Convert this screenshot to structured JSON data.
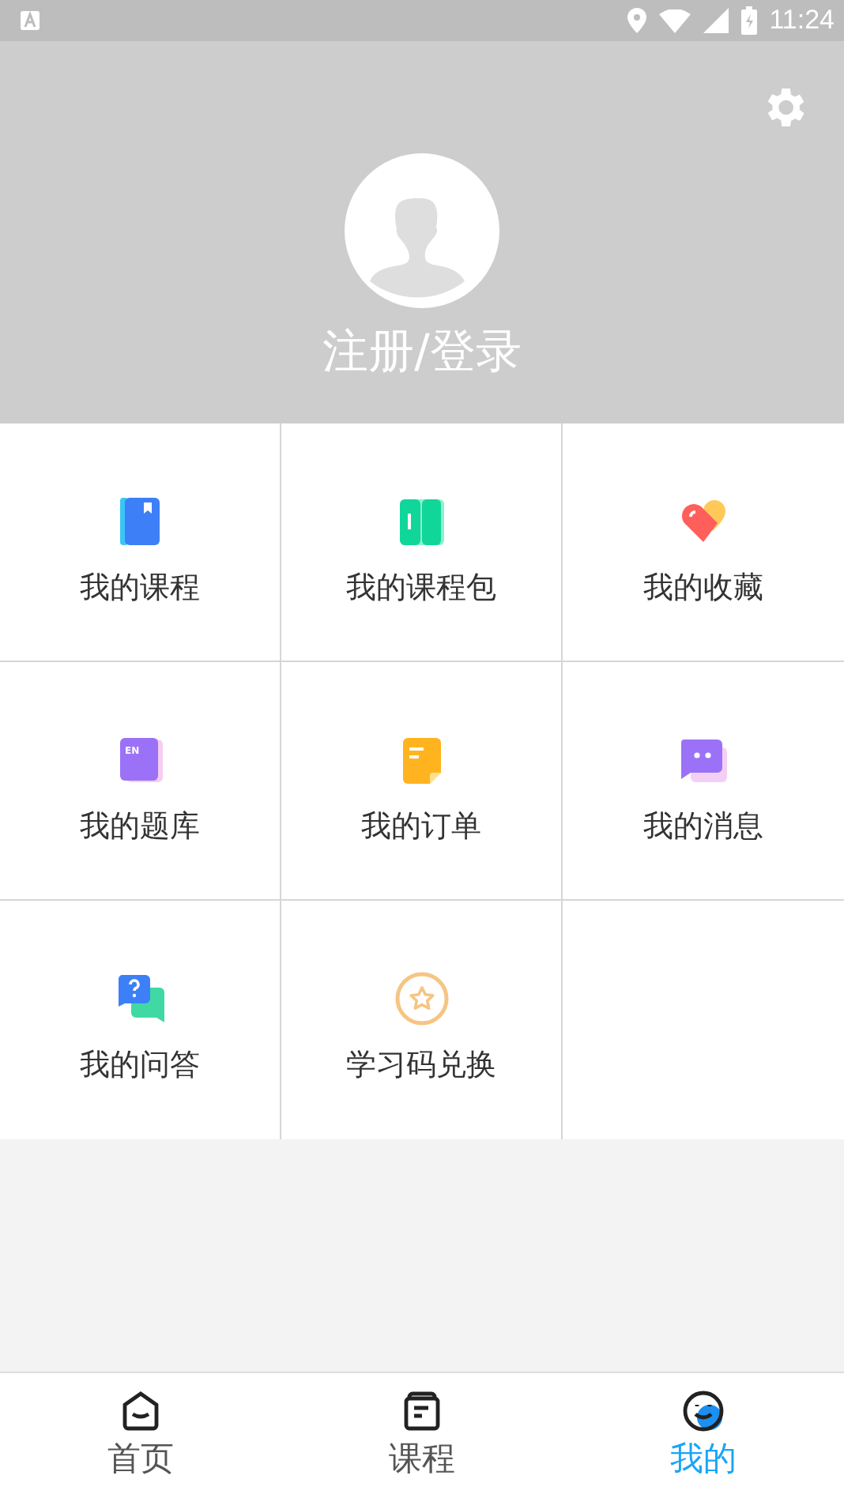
{
  "status_bar": {
    "time": "11:24"
  },
  "profile": {
    "login_label": "注册/登录"
  },
  "menu": [
    {
      "kind": "course",
      "label": "我的课程"
    },
    {
      "kind": "package",
      "label": "我的课程包"
    },
    {
      "kind": "favorite",
      "label": "我的收藏"
    },
    {
      "kind": "questions",
      "label": "我的题库",
      "icon_text": "EN"
    },
    {
      "kind": "order",
      "label": "我的订单"
    },
    {
      "kind": "message",
      "label": "我的消息"
    },
    {
      "kind": "qa",
      "label": "我的问答"
    },
    {
      "kind": "redeem",
      "label": "学习码兑换"
    }
  ],
  "tabs": [
    {
      "kind": "home",
      "label": "首页",
      "selected": false
    },
    {
      "kind": "course",
      "label": "课程",
      "selected": false
    },
    {
      "kind": "me",
      "label": "我的",
      "selected": true
    }
  ]
}
